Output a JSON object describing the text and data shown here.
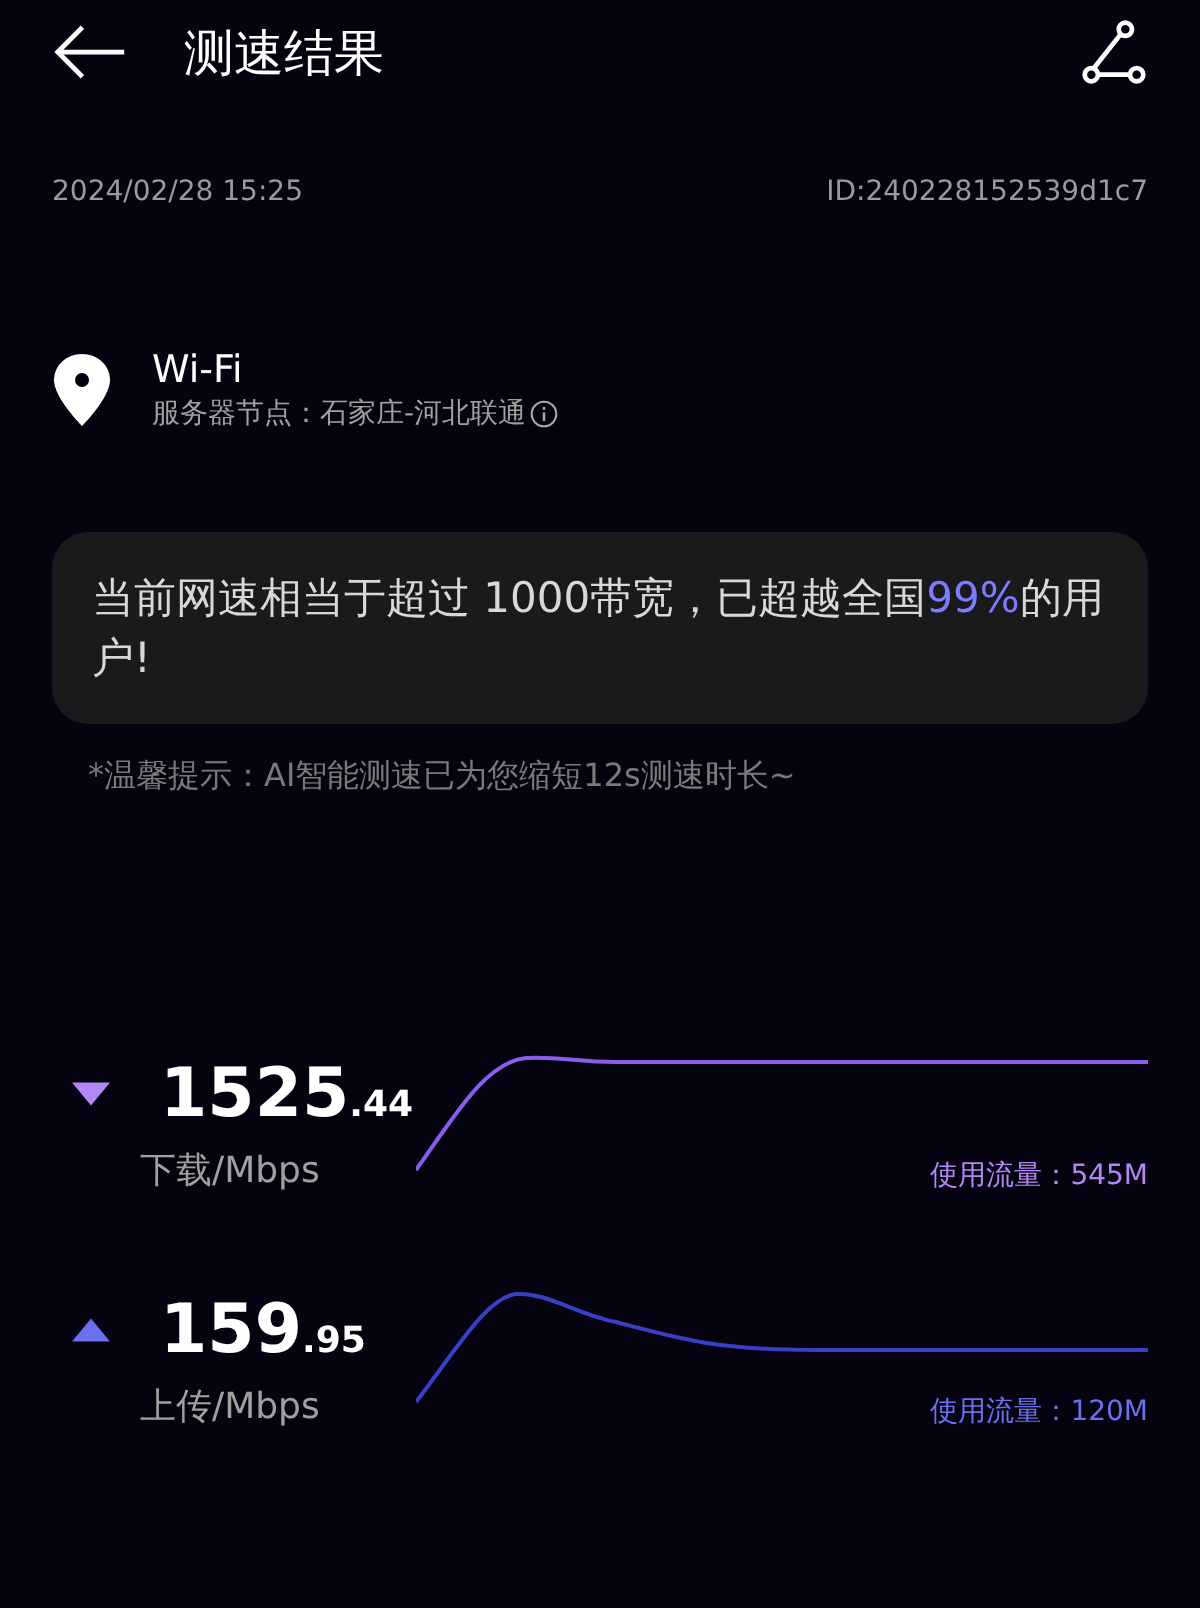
{
  "header": {
    "title": "测速结果"
  },
  "meta": {
    "datetime": "2024/02/28 15:25",
    "id": "ID:240228152539d1c7"
  },
  "network": {
    "name": "Wi-Fi",
    "server": "服务器节点：石家庄-河北联通"
  },
  "summary": {
    "before": "当前网速相当于超过 1000带宽，已超越全国",
    "highlight": "99%",
    "after": "的用户!"
  },
  "tip": "*温馨提示：AI智能测速已为您缩短12s测速时长~",
  "results": [
    {
      "kind": "download",
      "color": "#b388f5",
      "integer": "1525",
      "decimal": ".44",
      "unit": "下载/Mbps",
      "usage": "使用流量：545M"
    },
    {
      "kind": "upload",
      "color": "#6b70f0",
      "integer": "159",
      "decimal": ".95",
      "unit": "上传/Mbps",
      "usage": "使用流量：120M"
    }
  ]
}
